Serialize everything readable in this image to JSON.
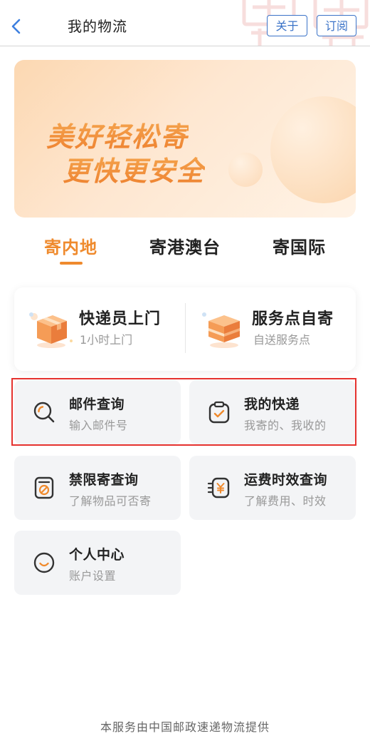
{
  "header": {
    "title": "我的物流",
    "about_label": "关于",
    "subscribe_label": "订阅",
    "back_icon": "chevron-left-icon"
  },
  "banner": {
    "line1": "美好轻松寄",
    "line2": "更快更安全"
  },
  "tabs": [
    {
      "label": "寄内地",
      "active": true
    },
    {
      "label": "寄港澳台",
      "active": false
    },
    {
      "label": "寄国际",
      "active": false
    }
  ],
  "send_options": [
    {
      "title": "快递员上门",
      "subtitle": "1小时上门",
      "icon": "courier-box-icon"
    },
    {
      "title": "服务点自寄",
      "subtitle": "自送服务点",
      "icon": "service-point-box-icon"
    }
  ],
  "services": [
    {
      "title": "邮件查询",
      "subtitle": "输入邮件号",
      "icon": "search-icon"
    },
    {
      "title": "我的快递",
      "subtitle": "我寄的、我收的",
      "icon": "clipboard-check-icon"
    },
    {
      "title": "禁限寄查询",
      "subtitle": "了解物品可否寄",
      "icon": "prohibited-icon"
    },
    {
      "title": "运费时效查询",
      "subtitle": "了解费用、时效",
      "icon": "yuan-icon"
    },
    {
      "title": "个人中心",
      "subtitle": "账户设置",
      "icon": "smile-icon"
    }
  ],
  "footer": {
    "text": "本服务由中国邮政速递物流提供"
  },
  "colors": {
    "accent": "#ef8a2d",
    "link": "#3b73c8",
    "highlight": "#e5322f",
    "tile": "#f3f4f6"
  }
}
